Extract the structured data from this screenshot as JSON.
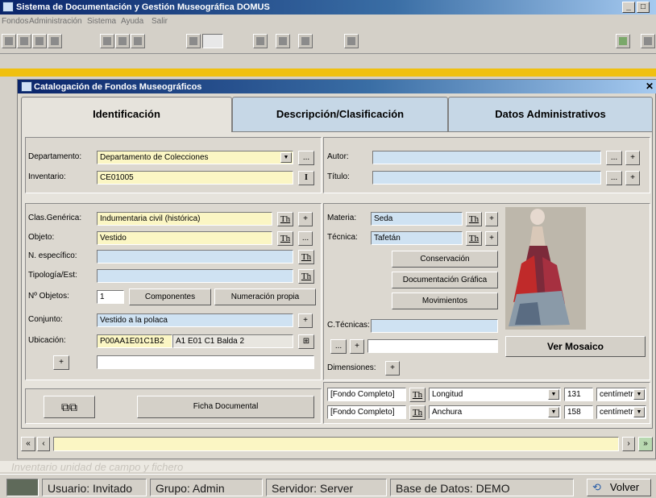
{
  "app": {
    "title": "Sistema de Documentación y Gestión Museográfica DOMUS",
    "menu": [
      "Fondos",
      "Administración",
      "Sistema",
      "Ayuda",
      "Salir"
    ]
  },
  "window": {
    "title": "Catalogación de Fondos Museográficos",
    "tabs": [
      "Identificación",
      "Descripción/Clasificación",
      "Datos Administrativos"
    ]
  },
  "form": {
    "departamento": {
      "label": "Departamento:",
      "value": "Departamento de Colecciones"
    },
    "inventario": {
      "label": "Inventario:",
      "value": "CE01005",
      "button": "I"
    },
    "autor": {
      "label": "Autor:",
      "value": ""
    },
    "titulo": {
      "label": "Título:",
      "value": ""
    },
    "clas_generica": {
      "label": "Clas.Genérica:",
      "value": "Indumentaria civil (histórica)"
    },
    "objeto": {
      "label": "Objeto:",
      "value": "Vestido"
    },
    "n_especifico": {
      "label": "N. específico:",
      "value": ""
    },
    "tipologia": {
      "label": "Tipología/Est:",
      "value": ""
    },
    "n_objetos": {
      "label": "Nº Objetos:",
      "value": "1"
    },
    "componentes_button": "Componentes",
    "numeracion_button": "Numeración propia",
    "conjunto": {
      "label": "Conjunto:",
      "value": "Vestido a la polaca"
    },
    "ubicacion": {
      "label": "Ubicación:",
      "code": "P00AA1E01C1B2",
      "desc": "A1 E01 C1 Balda 2"
    },
    "materia": {
      "label": "Materia:",
      "value": "Seda"
    },
    "tecnica": {
      "label": "Técnica:",
      "value": "Tafetán"
    },
    "conservacion_button": "Conservación",
    "documentacion_button": "Documentación Gráfica",
    "movimientos_button": "Movimientos",
    "ctecnicas_label": "C.Técnicas:",
    "ver_mosaico_button": "Ver Mosaico",
    "dimensiones_label": "Dimensiones:",
    "ficha_button": "Ficha Documental",
    "th_label": "Th",
    "plus": "+",
    "ellipsis": "...",
    "dimensiones": [
      {
        "parte": "[Fondo Completo]",
        "medida": "Longitud",
        "valor": "131",
        "unidad": "centímetr"
      },
      {
        "parte": "[Fondo Completo]",
        "medida": "Anchura",
        "valor": "158",
        "unidad": "centímetr"
      }
    ]
  },
  "status": {
    "usuario": "Usuario: Invitado",
    "grupo": "Grupo: Admin",
    "servidor": "Servidor: Server",
    "base": "Base de Datos: DEMO",
    "volver": "Volver",
    "faded_text": "Inventario unidad de campo y fichero"
  },
  "colors": {
    "titlebar": "#0a246a",
    "field_blue": "#cfe2f2",
    "field_yellow": "#fbf6c4",
    "yellowbar": "#f0c010"
  }
}
